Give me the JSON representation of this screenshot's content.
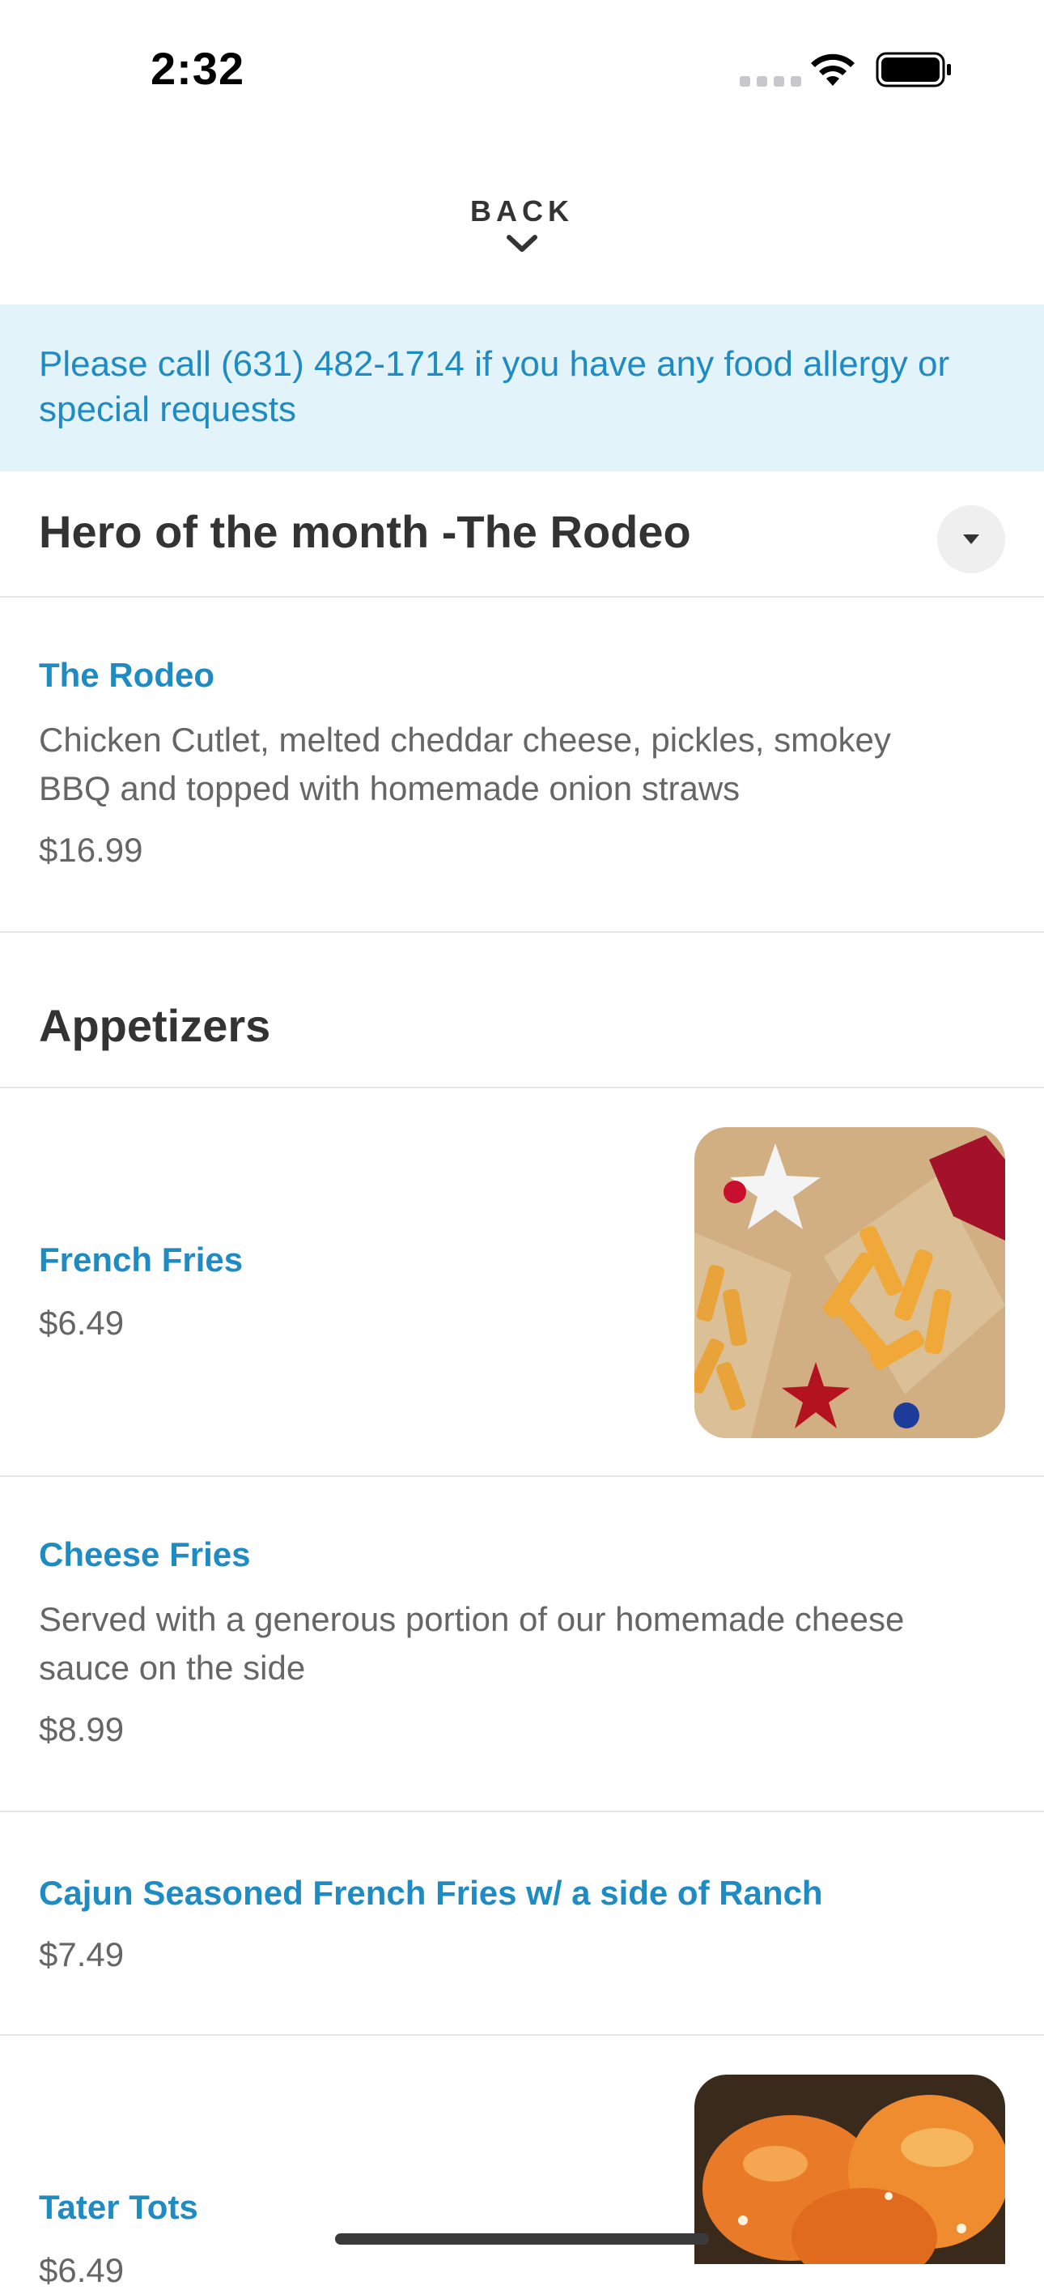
{
  "status_bar": {
    "time": "2:32"
  },
  "nav": {
    "back_label": "BACK"
  },
  "banner": {
    "text": "Please call (631) 482-1714 if you have any food allergy or special requests"
  },
  "sections": [
    {
      "title": "Hero of the month -The Rodeo",
      "items": [
        {
          "name": "The Rodeo",
          "description": "Chicken Cutlet, melted cheddar cheese, pickles, smokey BBQ and topped with homemade onion straws",
          "price": "$16.99"
        }
      ]
    },
    {
      "title": "Appetizers",
      "items": [
        {
          "name": "French Fries",
          "price": "$6.49",
          "image": "french-fries-photo"
        },
        {
          "name": "Cheese Fries",
          "description": "Served with a generous portion of our homemade cheese sauce on the side",
          "price": "$8.99"
        },
        {
          "name": "Cajun Seasoned French Fries w/ a side of Ranch",
          "price": "$7.49"
        },
        {
          "name": "Tater Tots",
          "price": "$6.49",
          "image": "tater-tots-photo"
        }
      ]
    }
  ],
  "colors": {
    "accent": "#1e8bc3",
    "banner_bg": "#e3f3fa",
    "text_primary": "#333333",
    "text_secondary": "#666666"
  }
}
